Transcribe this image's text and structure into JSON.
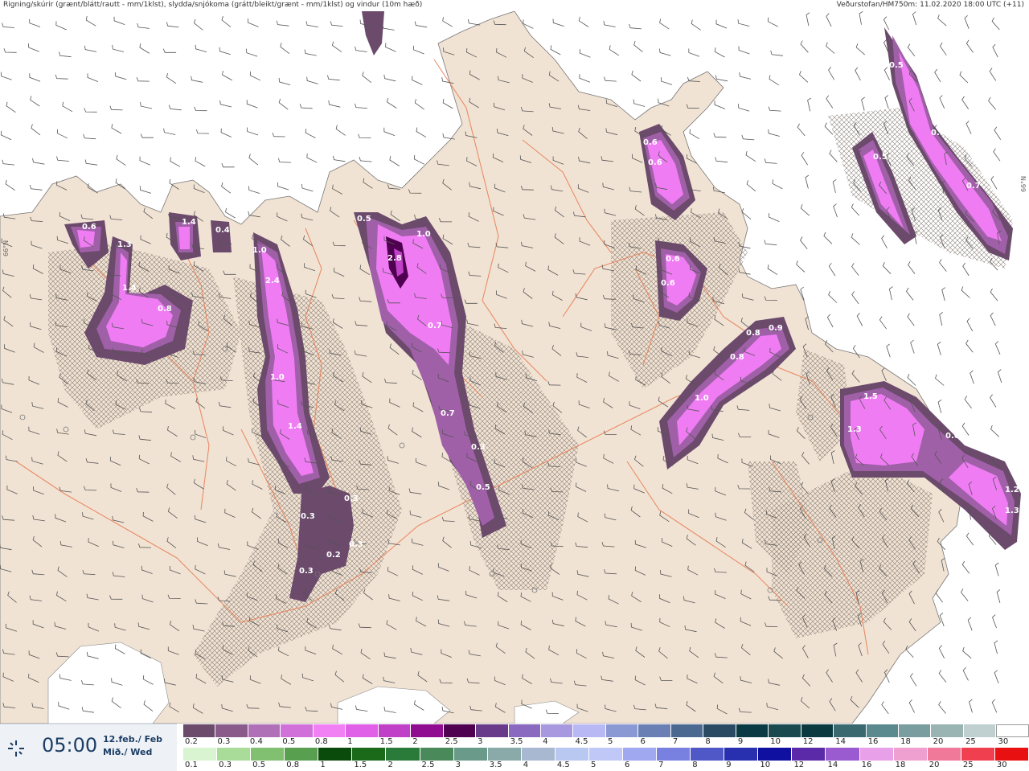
{
  "header": {
    "title": "Rigning/skúrir (grænt/blátt/rautt - mm/1klst), slydda/snjókoma (grátt/bleikt/grænt - mm/1klst) og vindur (10m hæð)",
    "source": "Veðurstofan/HM750m: 11.02.2020 18:00 UTC (+11)"
  },
  "time": {
    "value": "05:00",
    "date_line1": "12.feb./ Feb",
    "date_line2": "Mið./ Wed"
  },
  "grid_labels": {
    "left": "66°N",
    "right": "66°N"
  },
  "map_values": [
    {
      "id": "v1",
      "text": "0.6"
    },
    {
      "id": "v2",
      "text": "1.3"
    },
    {
      "id": "v3",
      "text": "1.4"
    },
    {
      "id": "v4",
      "text": "0.8"
    },
    {
      "id": "v5",
      "text": "1.4"
    },
    {
      "id": "v6",
      "text": "0.4"
    },
    {
      "id": "v7",
      "text": "1.0"
    },
    {
      "id": "v8",
      "text": "2.4"
    },
    {
      "id": "v9",
      "text": "1.0"
    },
    {
      "id": "v10",
      "text": "1.4"
    },
    {
      "id": "v11",
      "text": "0.3"
    },
    {
      "id": "v12",
      "text": "0.3"
    },
    {
      "id": "v13",
      "text": "0.2"
    },
    {
      "id": "v14",
      "text": "0.3"
    },
    {
      "id": "v15",
      "text": "0.3"
    },
    {
      "id": "v16",
      "text": "0.5"
    },
    {
      "id": "v17",
      "text": "1.0"
    },
    {
      "id": "v18",
      "text": "2.8"
    },
    {
      "id": "v19",
      "text": "0.7"
    },
    {
      "id": "v20",
      "text": "0.7"
    },
    {
      "id": "v21",
      "text": "0.3"
    },
    {
      "id": "v22",
      "text": "0.5"
    },
    {
      "id": "v23",
      "text": "0.6"
    },
    {
      "id": "v24",
      "text": "0.6"
    },
    {
      "id": "v25",
      "text": "0.6"
    },
    {
      "id": "v26",
      "text": "0.6"
    },
    {
      "id": "v27",
      "text": "0.8"
    },
    {
      "id": "v28",
      "text": "0.9"
    },
    {
      "id": "v29",
      "text": "0.8"
    },
    {
      "id": "v30",
      "text": "1.0"
    },
    {
      "id": "v31",
      "text": "1.5"
    },
    {
      "id": "v32",
      "text": "1.3"
    },
    {
      "id": "v33",
      "text": "0.6"
    },
    {
      "id": "v34",
      "text": "1.2"
    },
    {
      "id": "v35",
      "text": "1.3"
    },
    {
      "id": "v36",
      "text": "0.5"
    },
    {
      "id": "v37",
      "text": "0.7"
    },
    {
      "id": "v38",
      "text": "0.5"
    },
    {
      "id": "v39",
      "text": "0.7"
    }
  ],
  "snow_scale": {
    "labels": [
      "0.2",
      "0.3",
      "0.4",
      "0.5",
      "0.8",
      "1",
      "1.5",
      "2",
      "2.5",
      "3",
      "3.5",
      "4",
      "4.5",
      "5",
      "6",
      "7",
      "8",
      "9",
      "10",
      "12",
      "14",
      "16",
      "18",
      "20",
      "25",
      "30"
    ],
    "colors": [
      "#6b4a6b",
      "#8a5a8a",
      "#b070b8",
      "#d070d8",
      "#f080f4",
      "#e060e8",
      "#c040c8",
      "#900c90",
      "#500050",
      "#6a3a8a",
      "#8a6ac0",
      "#a898e0",
      "#b8b8f4",
      "#8a98d4",
      "#6a80b4",
      "#4a6890",
      "#2a4a64",
      "#0a3a44",
      "#1a4a50",
      "#0a3a40",
      "#3a6a70",
      "#5a8a8e",
      "#7a9ea0",
      "#9ab4b4",
      "#c0d0d0",
      "#ffffff"
    ]
  },
  "rain_scale": {
    "labels": [
      "0.1",
      "0.3",
      "0.5",
      "0.8",
      "1",
      "1.5",
      "2",
      "2.5",
      "3",
      "3.5",
      "4",
      "4.5",
      "5",
      "6",
      "7",
      "8",
      "9",
      "10",
      "12",
      "14",
      "16",
      "18",
      "20",
      "25",
      "30"
    ],
    "colors": [
      "#d8f4d0",
      "#a8dc98",
      "#80c070",
      "#58a050",
      "#0a4a0a",
      "#1a6a1a",
      "#2a7a3a",
      "#4a8a5a",
      "#6a9a8a",
      "#8aaaaa",
      "#a8b8d0",
      "#b8c8f0",
      "#c0c8f8",
      "#a0a8f0",
      "#7880e0",
      "#5058c8",
      "#2830b0",
      "#1010a0",
      "#5a2aa8",
      "#9a5ad0",
      "#e8a0e8",
      "#f0a0d0",
      "#f07898",
      "#f04050",
      "#e81010"
    ]
  }
}
